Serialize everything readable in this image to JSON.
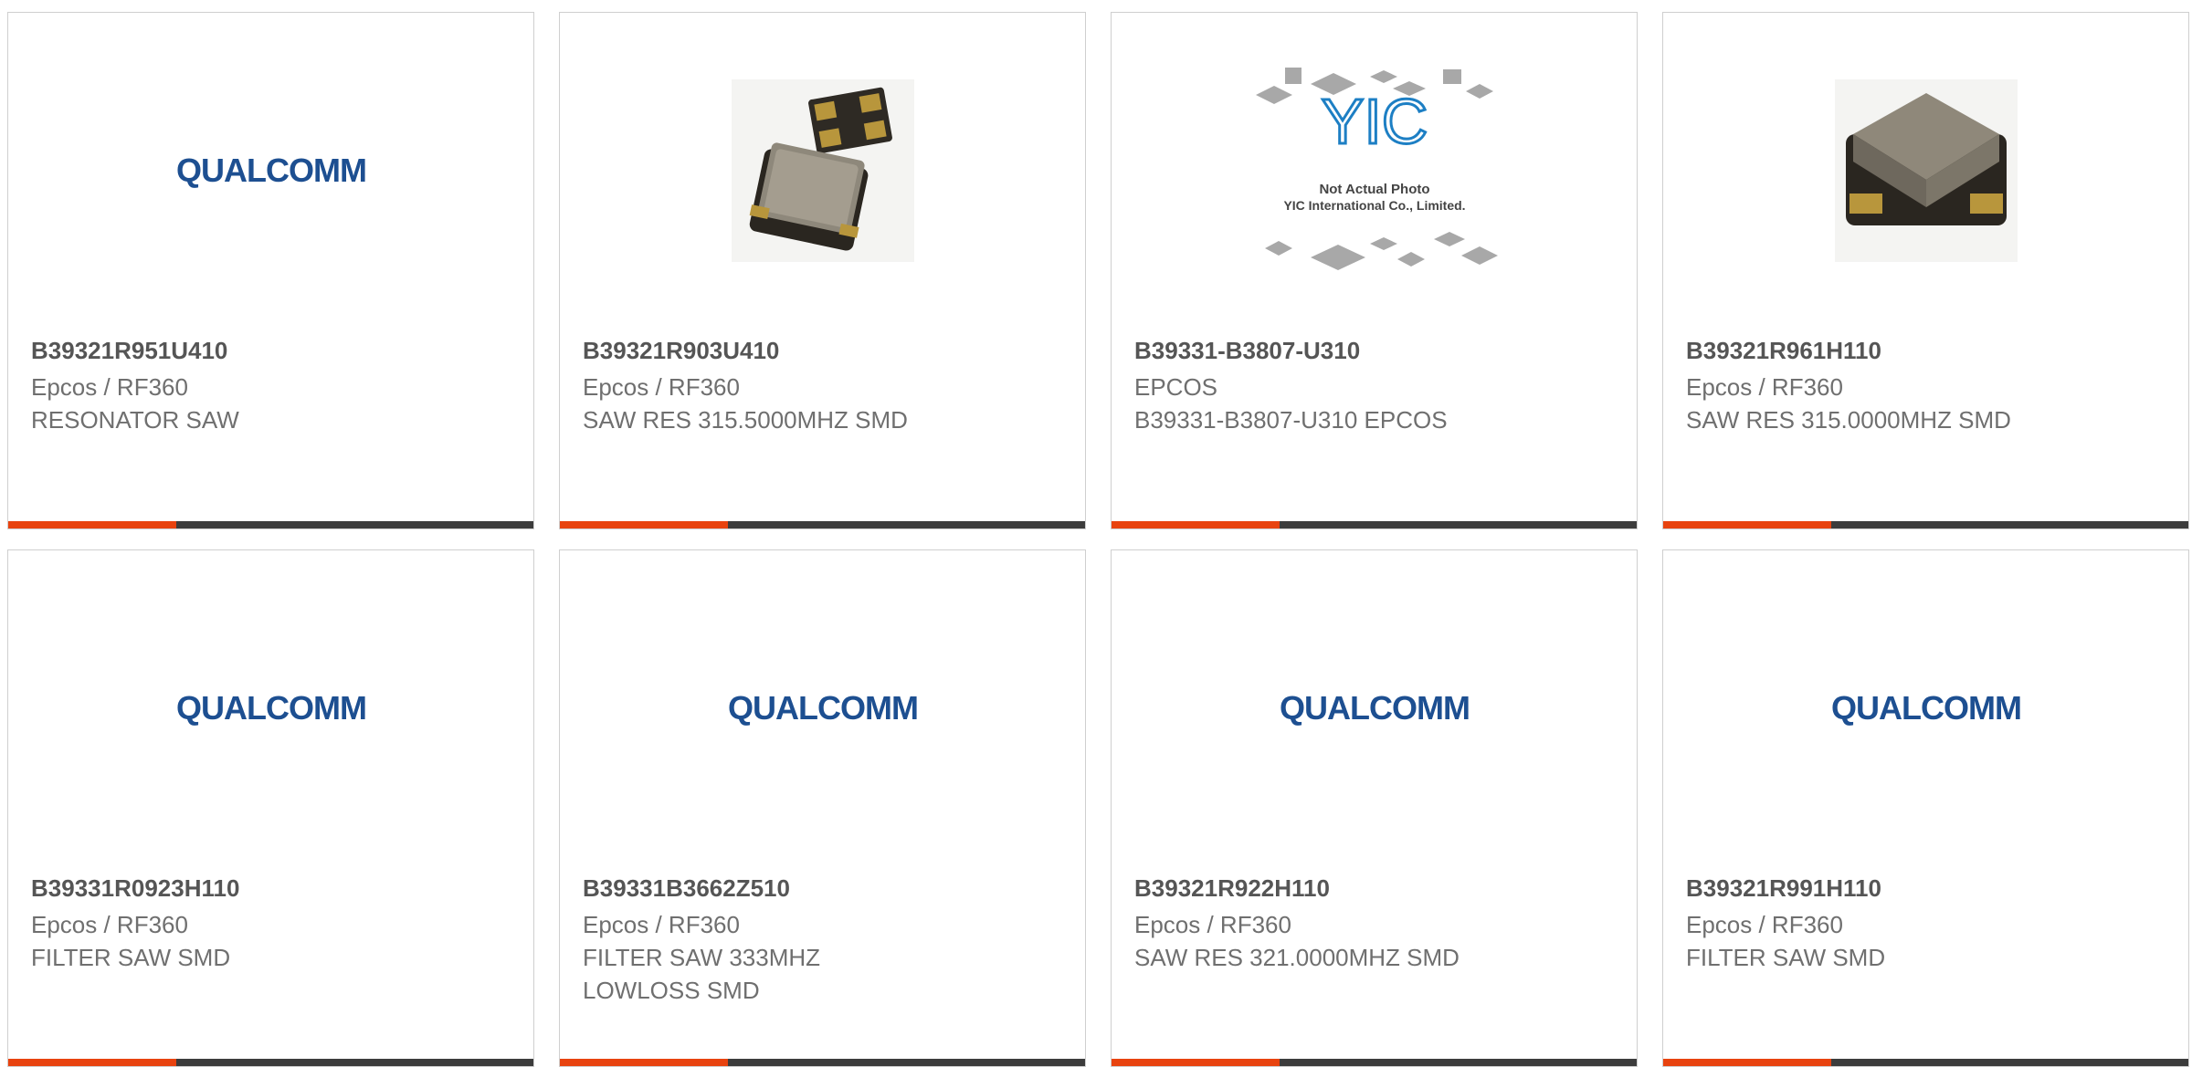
{
  "brand": {
    "accent": "#e8430f",
    "bar": "#3c3c3c",
    "qualcomm_blue": "#1d4f91"
  },
  "products": [
    {
      "part": "B39321R951U410",
      "manufacturer": "Epcos / RF360",
      "description": "RESONATOR SAW",
      "image": "qualcomm-logo",
      "logo_text": "QUALCOMM"
    },
    {
      "part": "B39321R903U410",
      "manufacturer": "Epcos / RF360",
      "description": "SAW RES 315.5000MHZ SMD",
      "image": "component-photo"
    },
    {
      "part": "B39331-B3807-U310",
      "manufacturer": "EPCOS",
      "description": "B39331-B3807-U310 EPCOS",
      "image": "yic-placeholder",
      "placeholder_logo": "YIC",
      "placeholder_line1": "Not Actual Photo",
      "placeholder_line2": "YIC International Co., Limited."
    },
    {
      "part": "B39321R961H110",
      "manufacturer": "Epcos / RF360",
      "description": "SAW RES 315.0000MHZ SMD",
      "image": "component-photo"
    },
    {
      "part": "B39331R0923H110",
      "manufacturer": "Epcos / RF360",
      "description": "FILTER SAW SMD",
      "image": "qualcomm-logo",
      "logo_text": "QUALCOMM"
    },
    {
      "part": "B39331B3662Z510",
      "manufacturer": "Epcos / RF360",
      "description": "FILTER SAW 333MHZ\nLOWLOSS SMD",
      "image": "qualcomm-logo",
      "logo_text": "QUALCOMM"
    },
    {
      "part": "B39321R922H110",
      "manufacturer": "Epcos / RF360",
      "description": "SAW RES 321.0000MHZ SMD",
      "image": "qualcomm-logo",
      "logo_text": "QUALCOMM"
    },
    {
      "part": "B39321R991H110",
      "manufacturer": "Epcos / RF360",
      "description": "FILTER SAW SMD",
      "image": "qualcomm-logo",
      "logo_text": "QUALCOMM"
    }
  ]
}
